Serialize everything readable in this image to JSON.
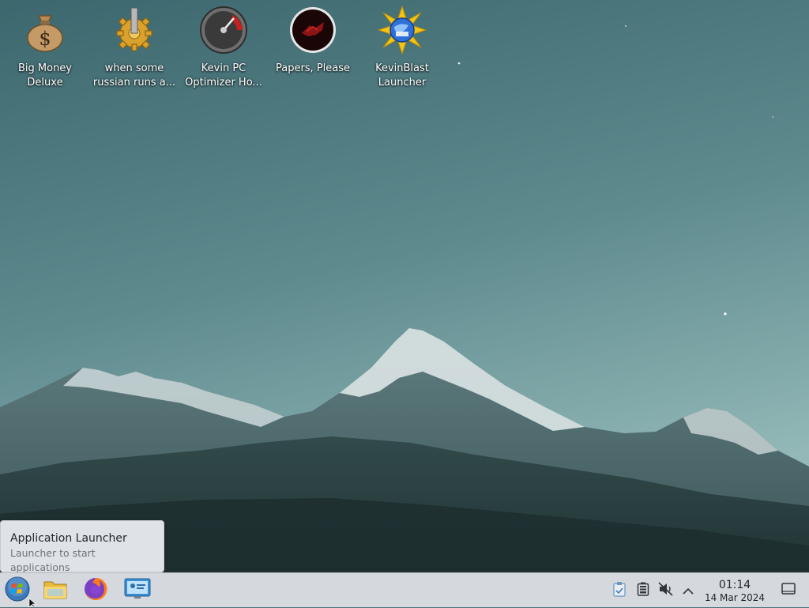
{
  "desktop": {
    "icons": [
      {
        "label": "Big Money Deluxe",
        "icon": "money-bag-icon"
      },
      {
        "label": "when some russian runs a...",
        "icon": "gear-icon"
      },
      {
        "label": "Kevin PC Optimizer Ho...",
        "icon": "speedometer-icon"
      },
      {
        "label": "Papers, Please",
        "icon": "papers-please-icon"
      },
      {
        "label": "KevinBlast Launcher",
        "icon": "starburst-globe-icon"
      }
    ]
  },
  "tooltip": {
    "title": "Application Launcher",
    "subtitle": "Launcher to start applications"
  },
  "taskbar": {
    "pinned": [
      {
        "name": "application-launcher",
        "icon": "windows-orb-icon"
      },
      {
        "name": "file-manager",
        "icon": "folder-icon"
      },
      {
        "name": "firefox",
        "icon": "firefox-icon"
      },
      {
        "name": "system-settings",
        "icon": "monitor-settings-icon"
      }
    ],
    "tray": [
      {
        "name": "clipboard",
        "icon": "clipboard-icon"
      },
      {
        "name": "battery",
        "icon": "battery-icon"
      },
      {
        "name": "volume-muted",
        "icon": "speaker-muted-icon"
      },
      {
        "name": "show-hidden",
        "icon": "chevron-up-icon"
      }
    ],
    "clock": {
      "time": "01:14",
      "date": "14 Mar 2024"
    }
  },
  "colors": {
    "sky_top": "#3f6a71",
    "sky_bottom": "#8fb5b4",
    "taskbar": "#d5d9de",
    "tooltip_bg": "#dfe3e8",
    "text_dark": "#232629",
    "text_muted": "#6e7478"
  }
}
